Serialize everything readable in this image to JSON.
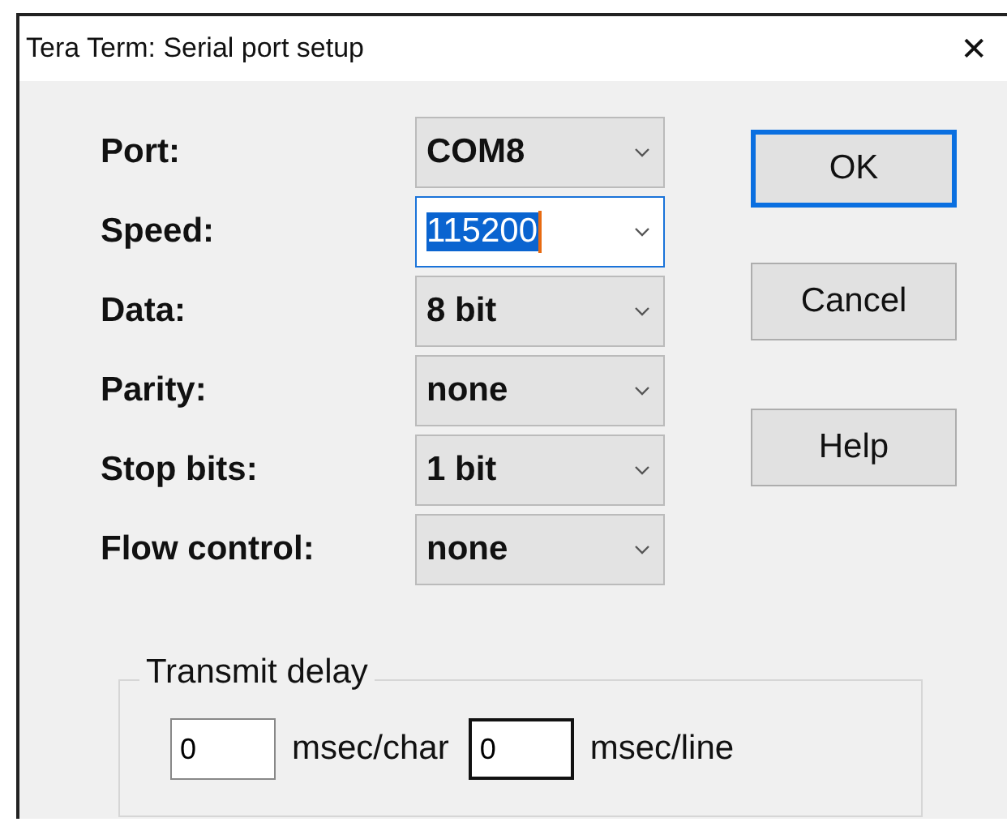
{
  "window": {
    "title": "Tera Term: Serial port setup",
    "close": "✕"
  },
  "fields": [
    {
      "label": "Port:",
      "value": "COM8",
      "focused": false
    },
    {
      "label": "Speed:",
      "value": "115200",
      "focused": true
    },
    {
      "label": "Data:",
      "value": "8 bit",
      "focused": false
    },
    {
      "label": "Parity:",
      "value": "none",
      "focused": false
    },
    {
      "label": "Stop bits:",
      "value": "1 bit",
      "focused": false
    },
    {
      "label": "Flow control:",
      "value": "none",
      "focused": false
    }
  ],
  "buttons": [
    {
      "label": "OK",
      "default": true
    },
    {
      "label": "Cancel",
      "default": false
    },
    {
      "label": "Help",
      "default": false
    }
  ],
  "transmit_delay": {
    "title": "Transmit delay",
    "char_value": "0",
    "char_unit": "msec/char",
    "line_value": "0",
    "line_unit": "msec/line"
  }
}
